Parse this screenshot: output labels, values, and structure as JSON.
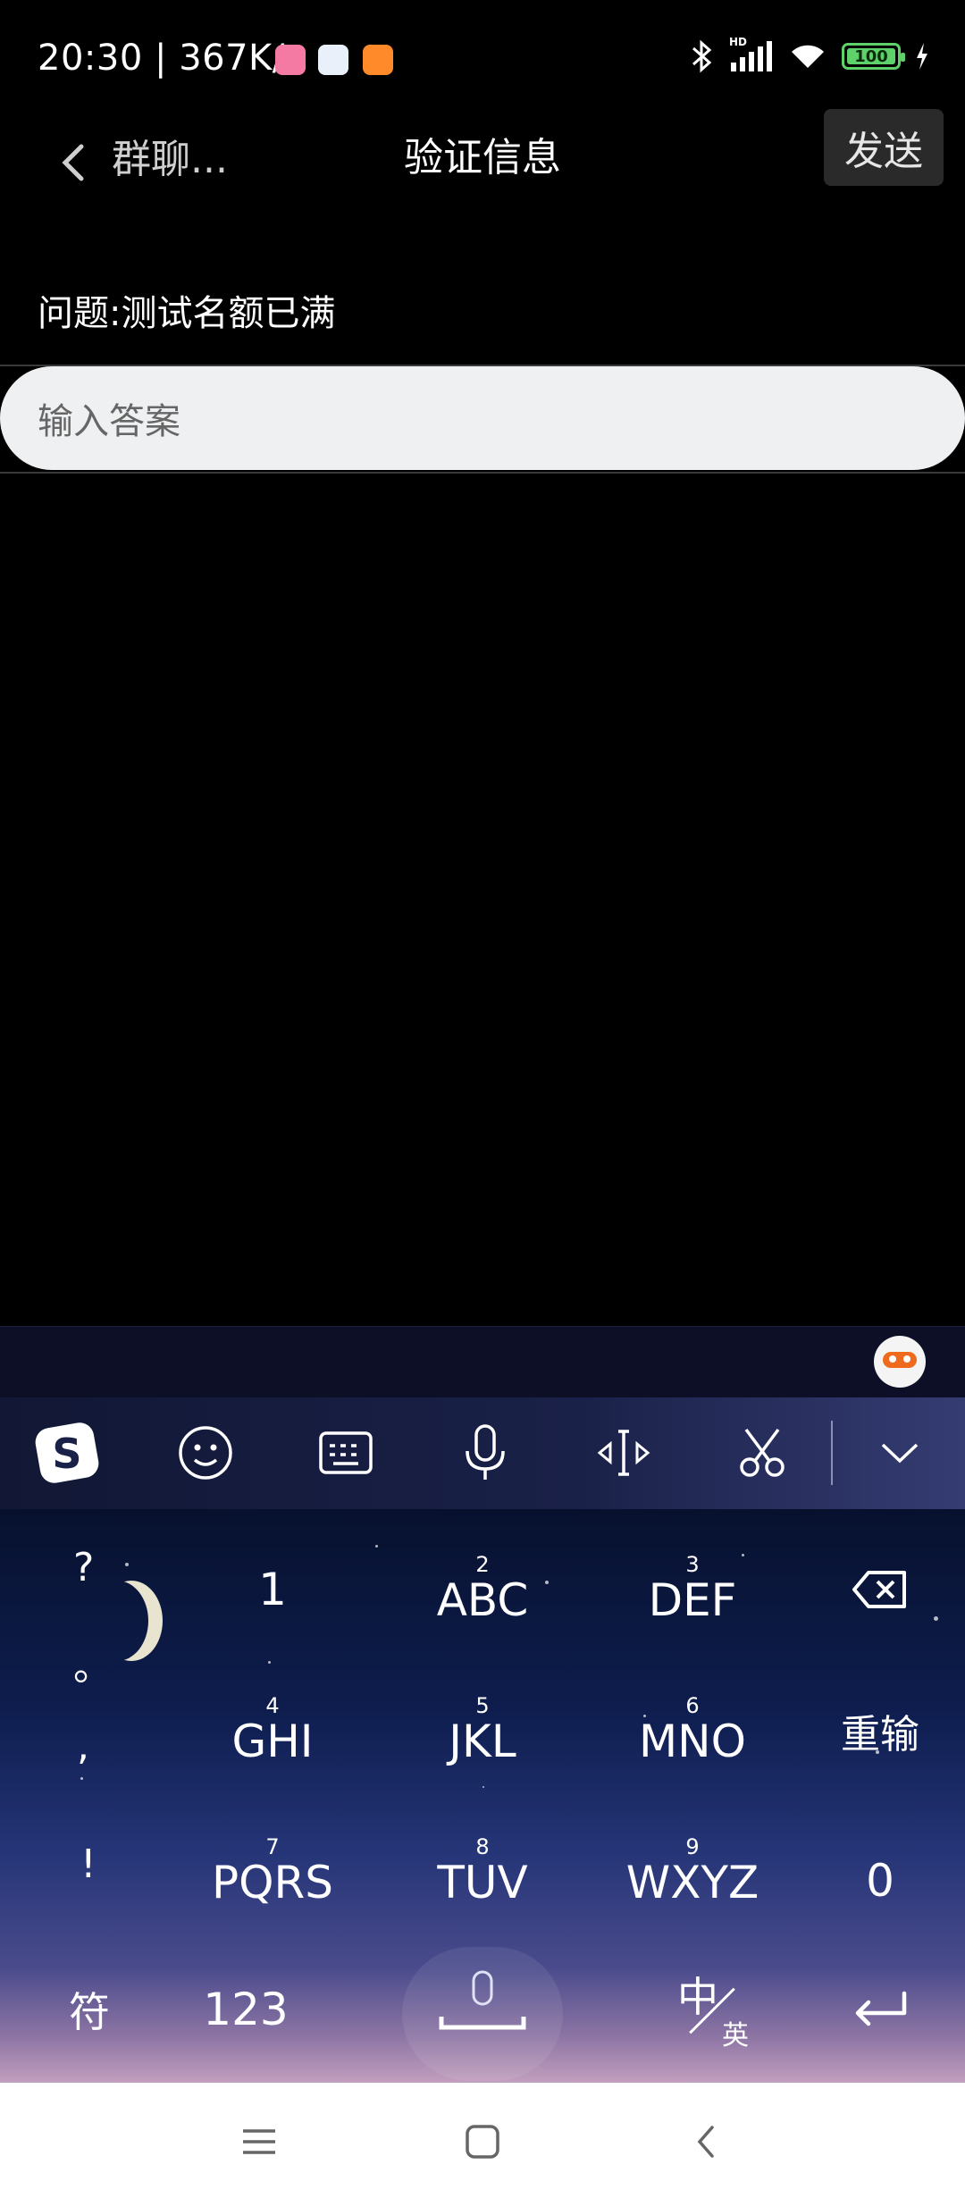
{
  "status_bar": {
    "time": "20:30",
    "speed": "367K/s",
    "battery": "100",
    "hd_label": "HD"
  },
  "top_bar": {
    "back_label": "群聊...",
    "title": "验证信息",
    "send_label": "发送"
  },
  "content": {
    "question": "问题:测试名额已满",
    "answer_placeholder": "输入答案"
  },
  "keyboard": {
    "left_column": [
      "?",
      "。",
      ",",
      "!"
    ],
    "rows": [
      [
        {
          "sup": "",
          "main": "1"
        },
        {
          "sup": "2",
          "main": "ABC"
        },
        {
          "sup": "3",
          "main": "DEF"
        }
      ],
      [
        {
          "sup": "4",
          "main": "GHI"
        },
        {
          "sup": "5",
          "main": "JKL"
        },
        {
          "sup": "6",
          "main": "MNO"
        }
      ],
      [
        {
          "sup": "7",
          "main": "PQRS"
        },
        {
          "sup": "8",
          "main": "TUV"
        },
        {
          "sup": "9",
          "main": "WXYZ"
        }
      ]
    ],
    "reinput_label": "重输",
    "zero_label": "0",
    "symbol_label": "符",
    "numeric_label": "123",
    "lang_main": "中",
    "lang_sub": "英"
  },
  "colors": {
    "battery": "#5ed16a",
    "answer_bg": "#eff0f2"
  }
}
